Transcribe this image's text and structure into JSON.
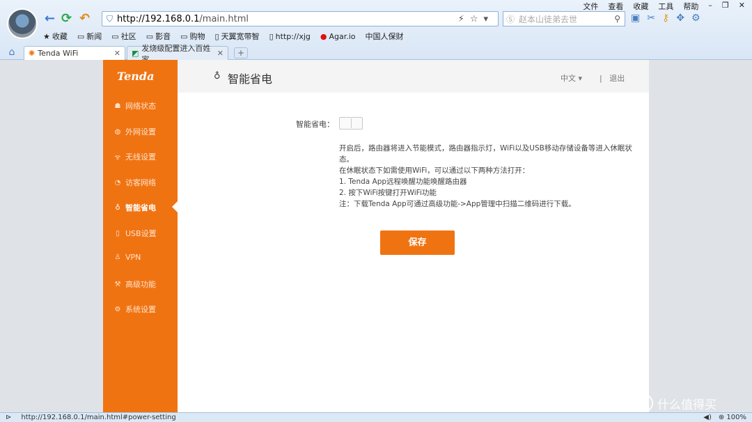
{
  "browser": {
    "url_host": "http://192.168.0.1",
    "url_path": "/main.html",
    "search_placeholder": "赵本山徒弟去世",
    "menu": [
      "文件",
      "查看",
      "收藏",
      "工具",
      "帮助"
    ],
    "bookmarks": [
      "收藏",
      "新闻",
      "社区",
      "影音",
      "购物",
      "天翼宽带智",
      "http://xjg",
      "Agar.io",
      "中国人保财"
    ],
    "tabs": [
      {
        "label": "Tenda WiFi"
      },
      {
        "label": "发烧级配置进入百姓家 ..."
      }
    ],
    "new_tab": "+"
  },
  "sidebar": {
    "logo": "Tenda",
    "items": [
      {
        "label": "网络状态",
        "icon": "network-status-icon"
      },
      {
        "label": "外网设置",
        "icon": "globe-icon"
      },
      {
        "label": "无线设置",
        "icon": "wifi-icon"
      },
      {
        "label": "访客网络",
        "icon": "guest-icon"
      },
      {
        "label": "智能省电",
        "icon": "bulb-icon"
      },
      {
        "label": "USB设置",
        "icon": "usb-icon"
      },
      {
        "label": "VPN",
        "icon": "vpn-icon"
      },
      {
        "label": "高级功能",
        "icon": "wrench-icon"
      },
      {
        "label": "系统设置",
        "icon": "gear-icon"
      }
    ]
  },
  "header": {
    "title": "智能省电",
    "lang": "中文",
    "logout": "退出"
  },
  "main": {
    "label": "智能省电：",
    "desc": [
      "开启后，路由器将进入节能模式，路由器指示灯，WiFi以及USB移动存储设备等进入休眠状",
      "态。",
      "在休眠状态下如需使用WiFi，可以通过以下两种方法打开：",
      "1. Tenda App远程唤醒功能唤醒路由器",
      "2. 按下WiFi按键打开WiFi功能",
      "注：下载Tenda App可通过高级功能->App管理中扫描二维码进行下载。"
    ],
    "save": "保存"
  },
  "status": {
    "url": "http://192.168.0.1/main.html#power-setting",
    "zoom": "100%"
  },
  "watermark": "什么值得买"
}
